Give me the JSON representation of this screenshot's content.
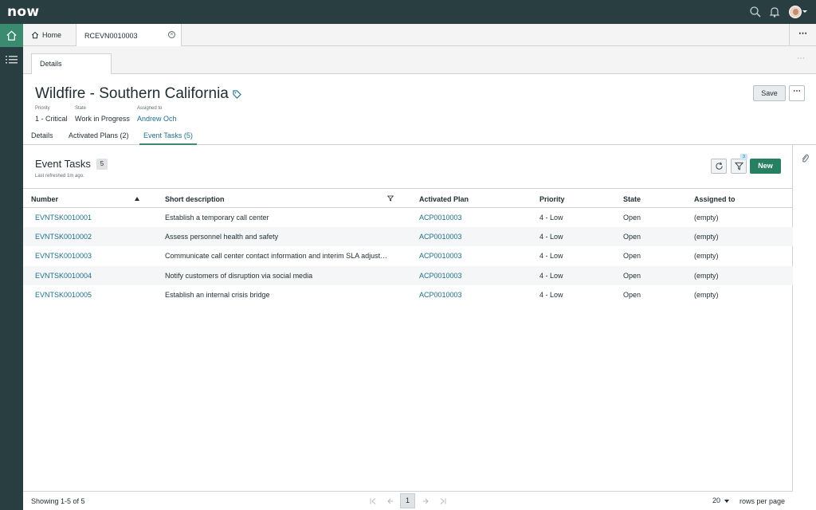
{
  "app": {
    "logo": "now"
  },
  "tabs": {
    "home_label": "Home",
    "record_label": "RCEVN0010003",
    "more": "⋯"
  },
  "form": {
    "section_tab": "Details",
    "title": "Wildfire - Southern California",
    "fields": [
      {
        "label": "Priority",
        "value": "1 - Critical"
      },
      {
        "label": "State",
        "value": "Work in Progress"
      },
      {
        "label": "Assigned to",
        "value": "Andrew Och"
      }
    ],
    "save_label": "Save",
    "more": "⋯"
  },
  "related_tabs": [
    {
      "label": "Details",
      "active": false
    },
    {
      "label": "Activated Plans (2)",
      "active": false
    },
    {
      "label": "Event Tasks (5)",
      "active": true
    }
  ],
  "list": {
    "title": "Event Tasks",
    "count": "5",
    "last_refreshed": "Last refreshed 1m ago.",
    "filter_count": "3",
    "new_label": "New",
    "columns": [
      "Number",
      "Short description",
      "Activated Plan",
      "Priority",
      "State",
      "Assigned to"
    ],
    "rows": [
      [
        "EVNTSK0010001",
        "Establish a temporary call center",
        "ACP0010003",
        "4 - Low",
        "Open",
        "(empty)"
      ],
      [
        "EVNTSK0010002",
        "Assess personnel health and safety",
        "ACP0010003",
        "4 - Low",
        "Open",
        "(empty)"
      ],
      [
        "EVNTSK0010003",
        "Communicate call center contact information and interim SLA adjust…",
        "ACP0010003",
        "4 - Low",
        "Open",
        "(empty)"
      ],
      [
        "EVNTSK0010004",
        "Notify customers of disruption via social media",
        "ACP0010003",
        "4 - Low",
        "Open",
        "(empty)"
      ],
      [
        "EVNTSK0010005",
        "Establish an internal crisis bridge",
        "ACP0010003",
        "4 - Low",
        "Open",
        "(empty)"
      ]
    ]
  },
  "footer": {
    "showing": "Showing 1-5 of 5",
    "current_page": "1",
    "rows_per_page_value": "20",
    "rows_per_page_label": "rows per page"
  },
  "colors": {
    "topbar": "#293e40",
    "accent": "#278062",
    "link": "#1d6f8a"
  }
}
